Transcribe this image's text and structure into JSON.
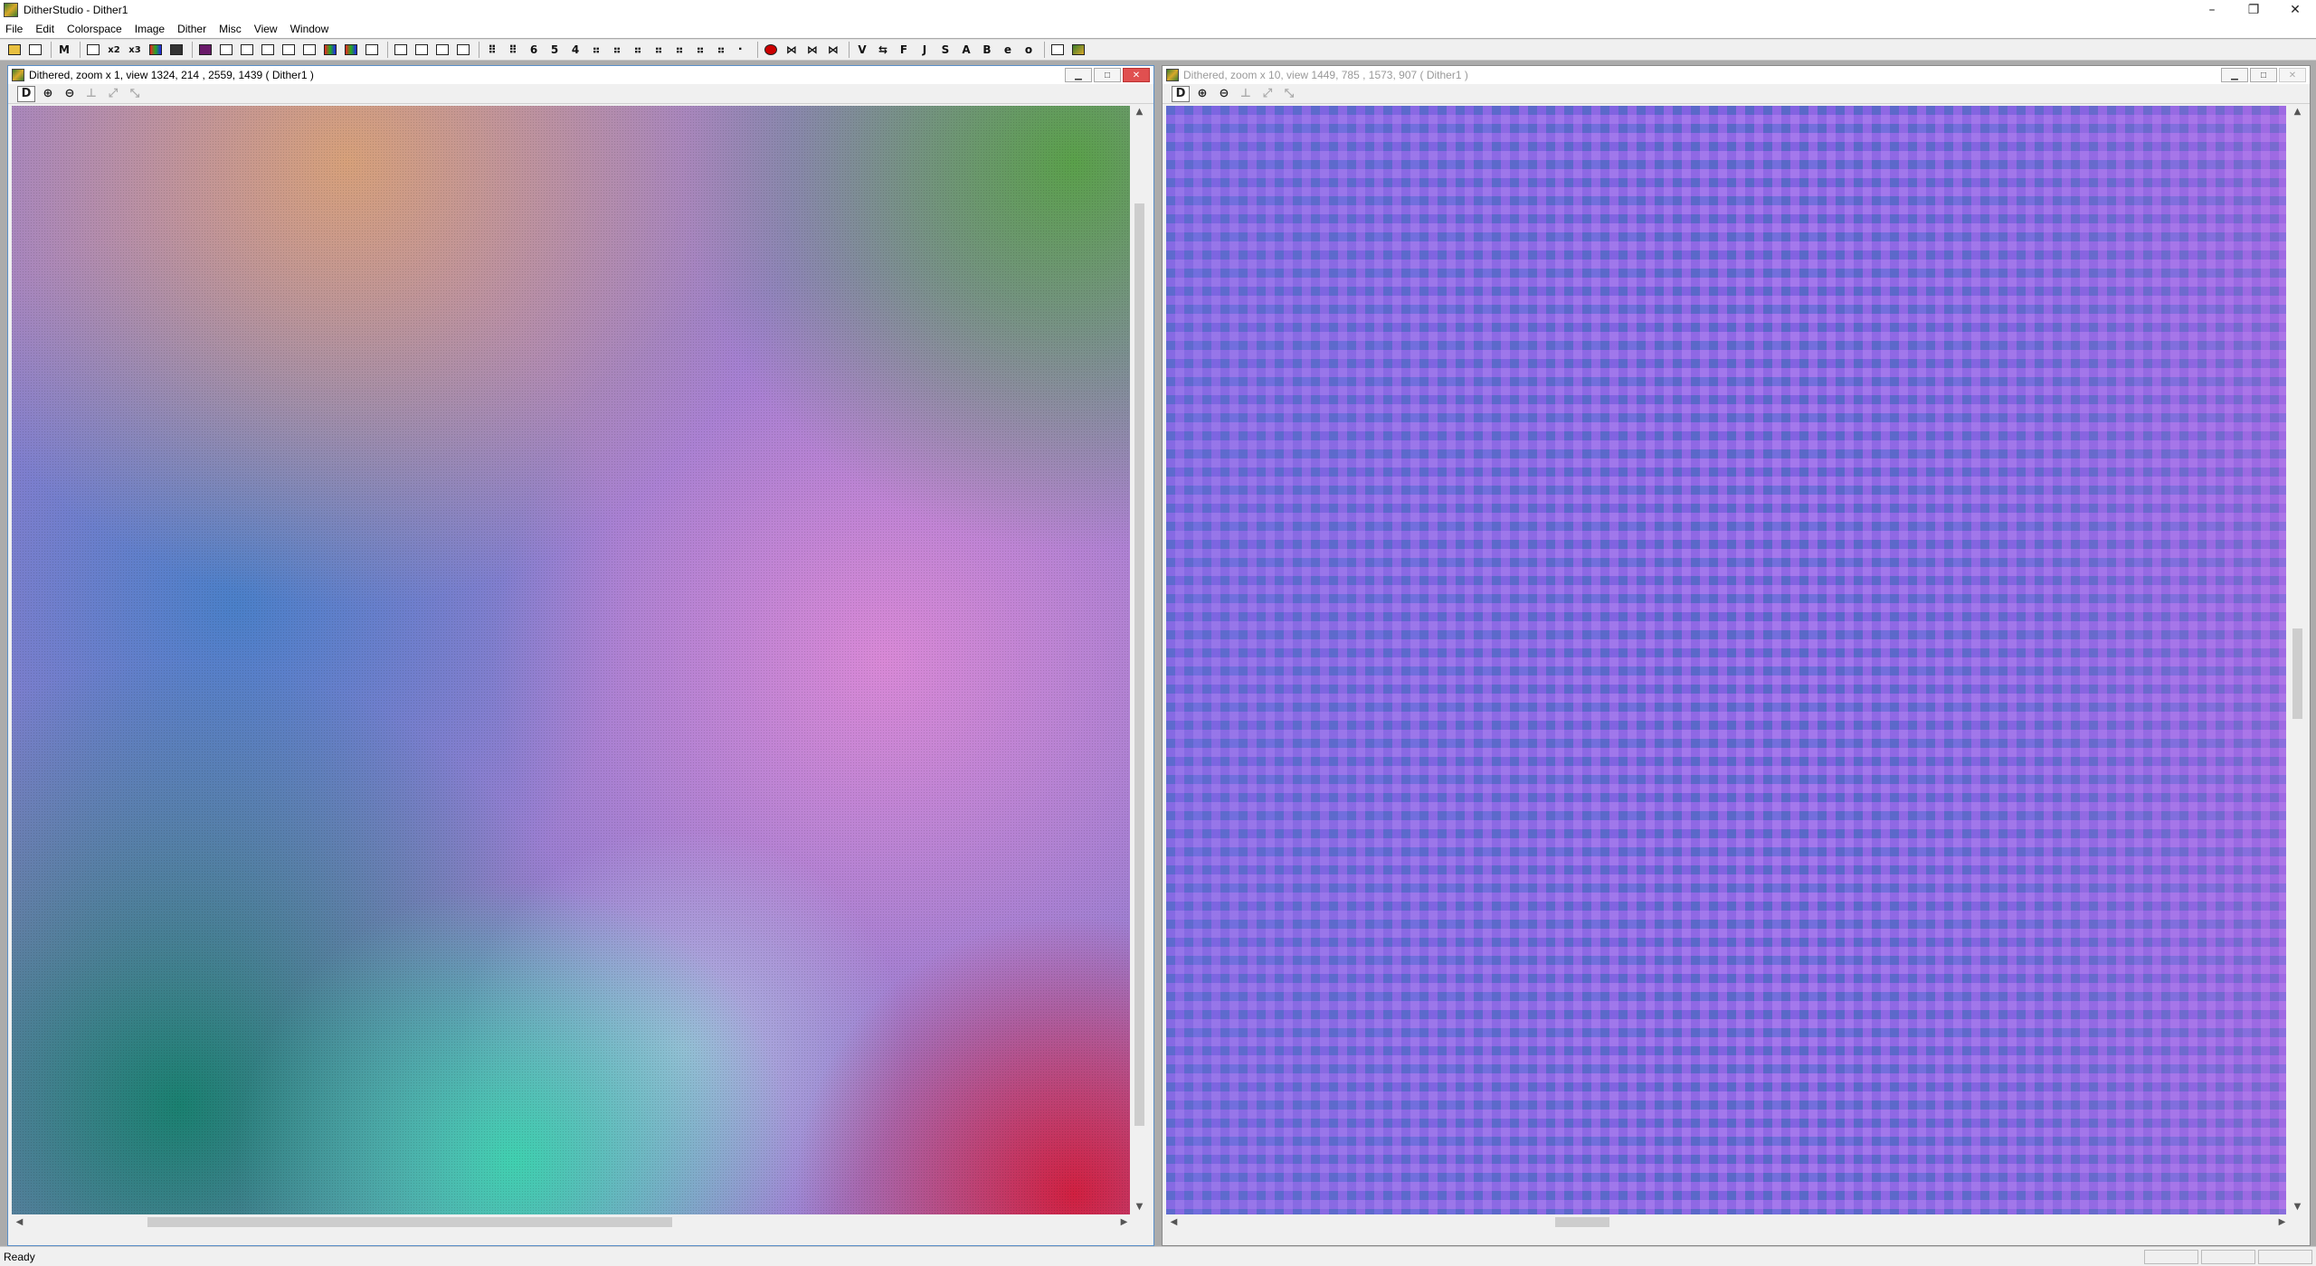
{
  "window": {
    "title": "DitherStudio - Dither1",
    "controls": [
      "–",
      "❐",
      "✕"
    ]
  },
  "menu": [
    {
      "label": "File"
    },
    {
      "label": "Edit"
    },
    {
      "label": "Colorspace"
    },
    {
      "label": "Image"
    },
    {
      "label": "Dither"
    },
    {
      "label": "Misc"
    },
    {
      "label": "View"
    },
    {
      "label": "Window"
    }
  ],
  "toolbar": {
    "text_buttons": [
      "M",
      "x2",
      "x3",
      "6",
      "5",
      "4",
      "V",
      "F",
      "J",
      "S",
      "A",
      "B",
      "e",
      "o"
    ]
  },
  "left_child": {
    "title": "Dithered, zoom x 1, view 1324, 214 , 2559, 1439 ( Dither1 )",
    "tool_d": "D",
    "colors": [
      "#d6a07a",
      "#4a7fc8",
      "#a87ad8",
      "#d888d6",
      "#22a08a",
      "#d8405a",
      "#5aa04a"
    ]
  },
  "right_child": {
    "title": "Dithered, zoom x 10, view 1449, 785 , 1573, 907 ( Dither1 )",
    "tool_d": "D",
    "colors": [
      "#8a6ae0",
      "#5a68c8",
      "#b070e0"
    ]
  },
  "status": {
    "text": "Ready"
  }
}
